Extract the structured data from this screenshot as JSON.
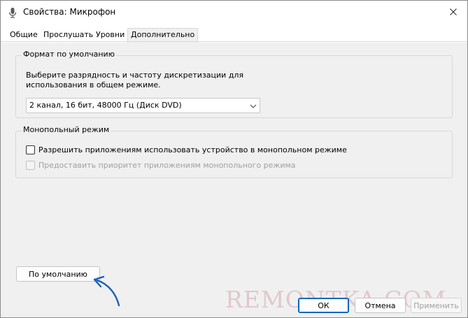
{
  "window": {
    "title": "Свойства: Микрофон",
    "title_icon": "microphone-icon",
    "close_icon": "close-icon"
  },
  "tabs": [
    {
      "label": "Общие"
    },
    {
      "label": "Прослушать"
    },
    {
      "label": "Уровни"
    },
    {
      "label": "Дополнительно",
      "active": true
    }
  ],
  "default_format": {
    "group_label": "Формат по умолчанию",
    "description_line1": "Выберите разрядность и частоту дискретизации для",
    "description_line2": "использования в общем режиме.",
    "selected_value": "2 канал, 16 бит, 48000 Гц (Диск DVD)"
  },
  "exclusive_mode": {
    "group_label": "Монопольный режим",
    "option1_label": "Разрешить приложениям использовать устройство в монопольном режиме",
    "option1_checked": false,
    "option2_label": "Предоставить приоритет приложениям монопольного режима",
    "option2_checked": false,
    "option2_disabled": true
  },
  "buttons": {
    "default_label": "По умолчанию",
    "ok_label": "ОК",
    "cancel_label": "Отмена",
    "apply_label": "Применить"
  },
  "watermark": "REMONTKA.COM",
  "colors": {
    "accent": "#0067c0",
    "annotation_arrow": "#1a5fb4"
  }
}
